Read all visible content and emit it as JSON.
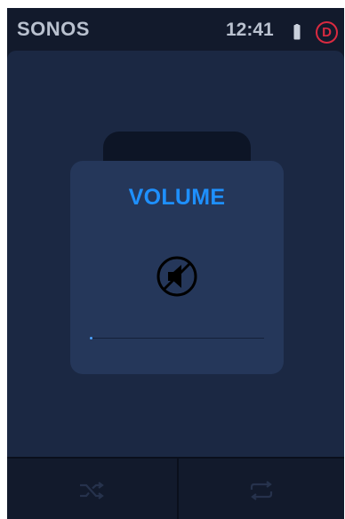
{
  "status_bar": {
    "brand": "SONOS",
    "time": "12:41",
    "profile_initial": "D"
  },
  "icons": {
    "battery": "battery-icon",
    "profile": "profile-badge-icon",
    "album": "music-note-icon",
    "mute": "speaker-muted-icon",
    "shuffle": "shuffle-icon",
    "repeat": "repeat-icon"
  },
  "volume_dialog": {
    "title": "VOLUME",
    "level": 0
  },
  "colors": {
    "background": "#121a2c",
    "panel": "#1b2843",
    "dialog": "#25375a",
    "accent": "#1e90ff",
    "profile_red": "#d92a40",
    "status_text": "#b9c1cf"
  }
}
